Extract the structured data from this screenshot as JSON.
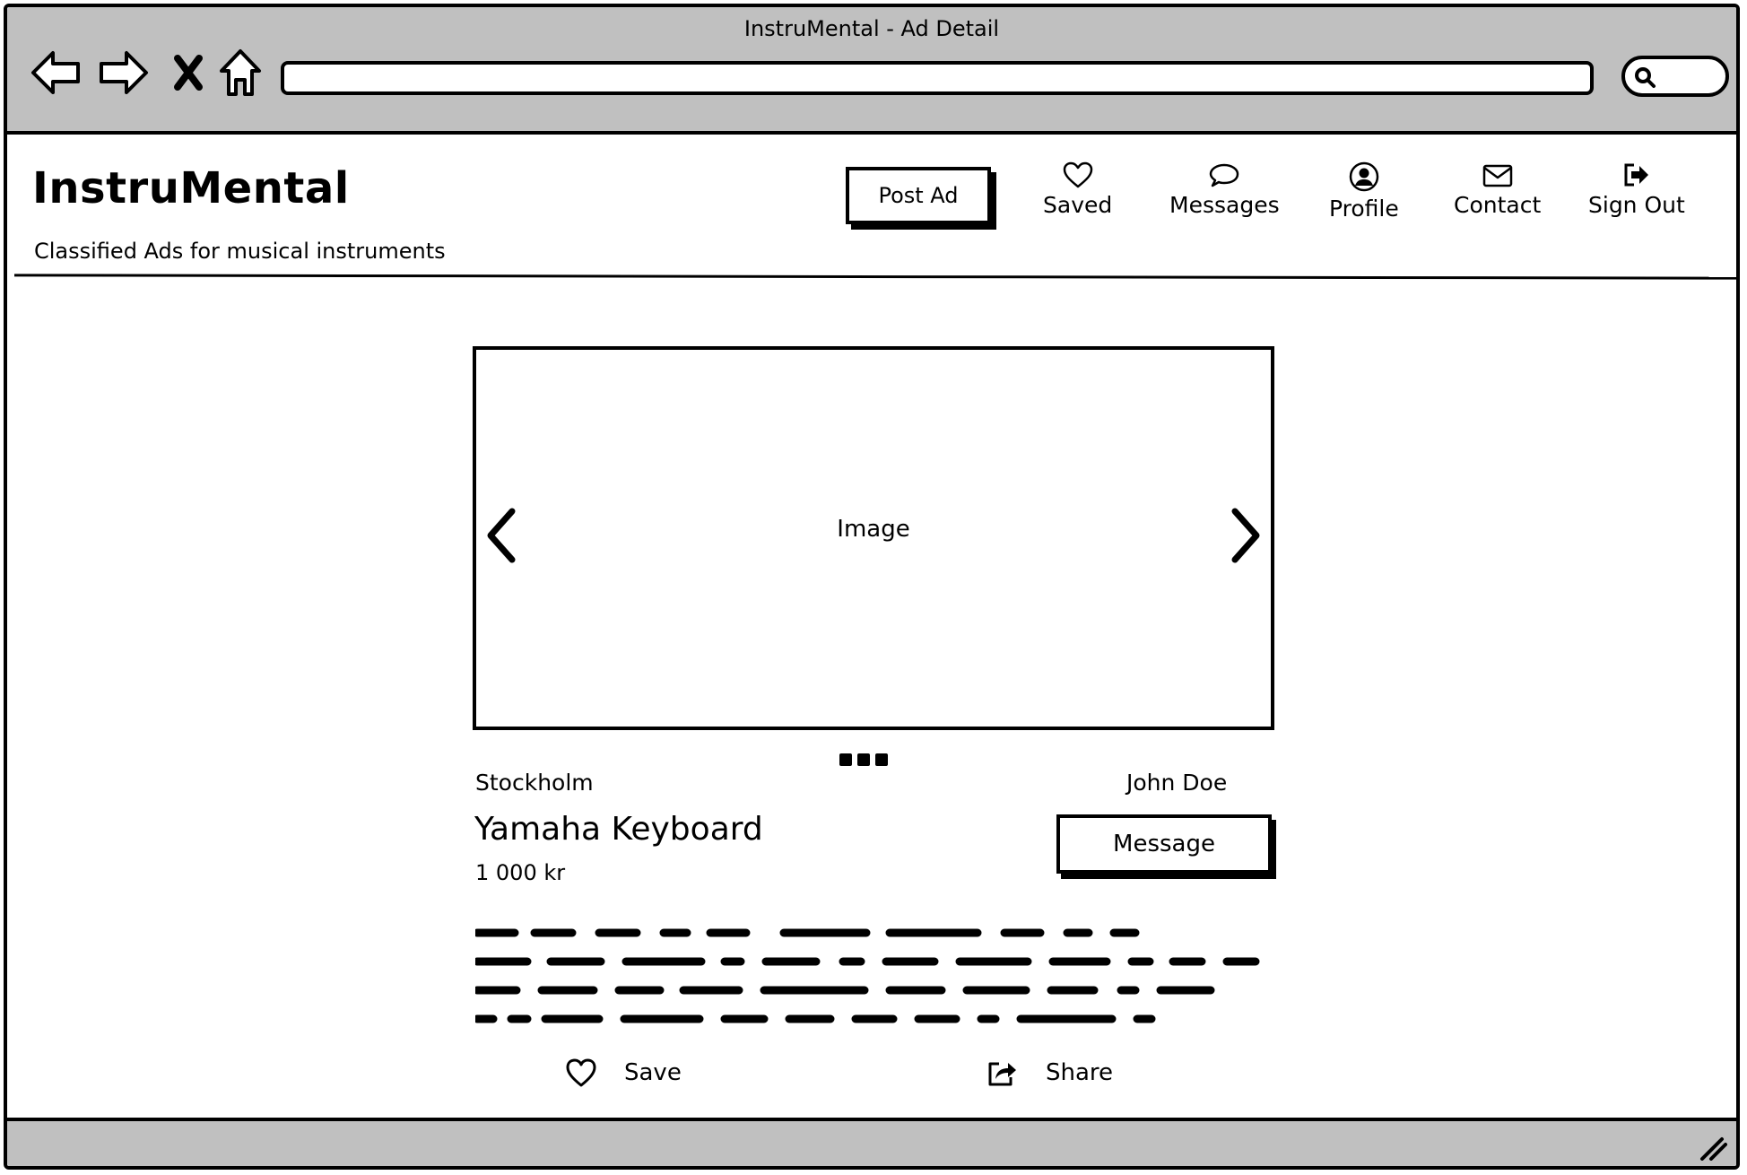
{
  "window": {
    "title": "InstruMental - Ad Detail"
  },
  "browser": {
    "url": ""
  },
  "header": {
    "brand": "InstruMental",
    "tagline": "Classified Ads for musical instruments",
    "post_ad": "Post Ad",
    "nav": [
      {
        "label": "Saved",
        "icon": "heart-icon"
      },
      {
        "label": "Messages",
        "icon": "chat-bubble-icon"
      },
      {
        "label": "Profile",
        "icon": "user-circle-icon"
      },
      {
        "label": "Contact",
        "icon": "envelope-icon"
      },
      {
        "label": "Sign Out",
        "icon": "sign-out-icon"
      }
    ]
  },
  "ad": {
    "image_label": "Image",
    "location": "Stockholm",
    "seller": "John Doe",
    "title": "Yamaha Keyboard",
    "price": "1 000 kr",
    "message_button": "Message",
    "description": "",
    "actions": {
      "save": "Save",
      "share": "Share"
    }
  }
}
